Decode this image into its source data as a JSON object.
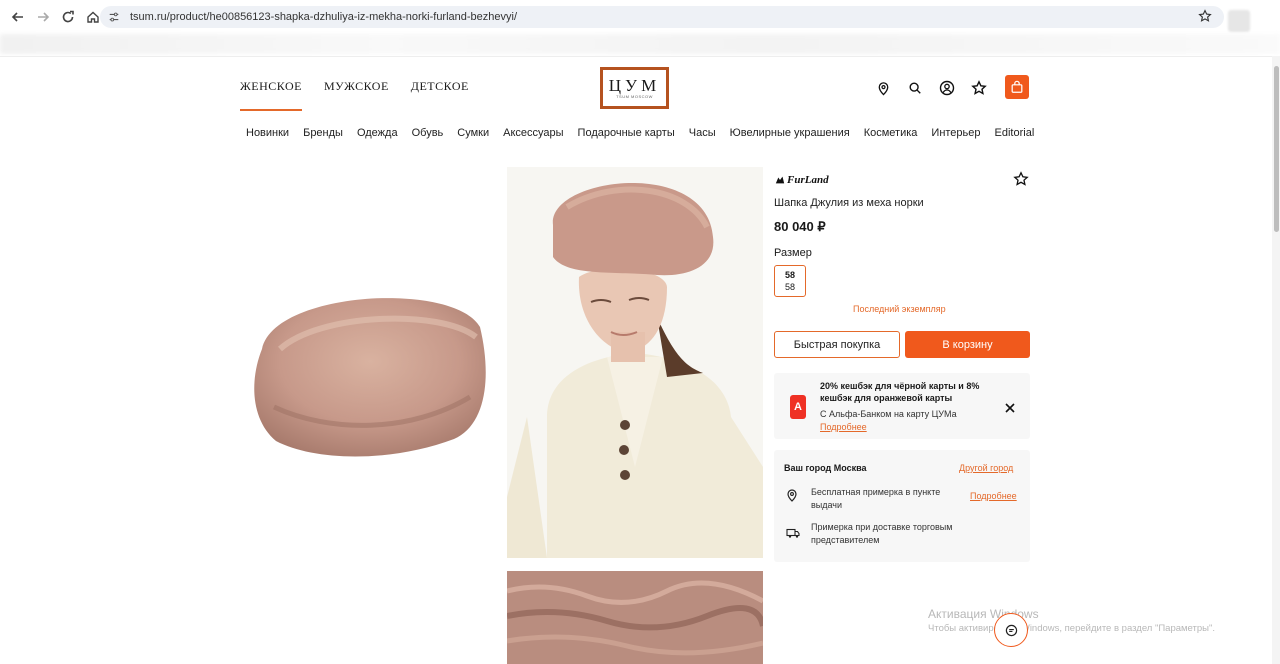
{
  "browser": {
    "url": "tsum.ru/product/he00856123-shapka-dzhuliya-iz-mekha-norki-furland-bezhevyi/"
  },
  "header": {
    "gender_tabs": [
      "ЖЕНСКОЕ",
      "МУЖСКОЕ",
      "ДЕТСКОЕ"
    ],
    "active_tab": "ЖЕНСКОЕ",
    "logo_text": "ЦУМ",
    "logo_sub": "TSUM MOSCOW"
  },
  "categories": [
    "Новинки",
    "Бренды",
    "Одежда",
    "Обувь",
    "Сумки",
    "Аксессуары",
    "Подарочные карты",
    "Часы",
    "Ювелирные украшения",
    "Косметика",
    "Интерьер",
    "Editorial"
  ],
  "product": {
    "brand": "FurLand",
    "name": "Шапка Джулия из меха норки",
    "price": "80 040 ₽",
    "size_label": "Размер",
    "size_value": "58",
    "size_sub": "58",
    "stock_note": "Последний экземпляр",
    "quick_buy_label": "Быстрая покупка",
    "add_to_cart_label": "В корзину"
  },
  "promo": {
    "bank_letter": "А",
    "title": "20% кешбэк для чёрной карты и 8% кешбэк для оранжевой карты",
    "subtitle": "С Альфа-Банком на карту ЦУМа",
    "more": "Подробнее"
  },
  "delivery": {
    "city_title": "Ваш город Москва",
    "other_city": "Другой город",
    "pickup_text": "Бесплатная примерка в пункте выдачи",
    "pickup_more": "Подробнее",
    "courier_text": "Примерка при доставке торговым представителем"
  },
  "overlay": {
    "windows_title": "Активация Windows",
    "windows_sub": "Чтобы активировать Windows, перейдите в раздел \"Параметры\"."
  },
  "colors": {
    "accent": "#f0591c",
    "logo_border": "#b5521f"
  }
}
